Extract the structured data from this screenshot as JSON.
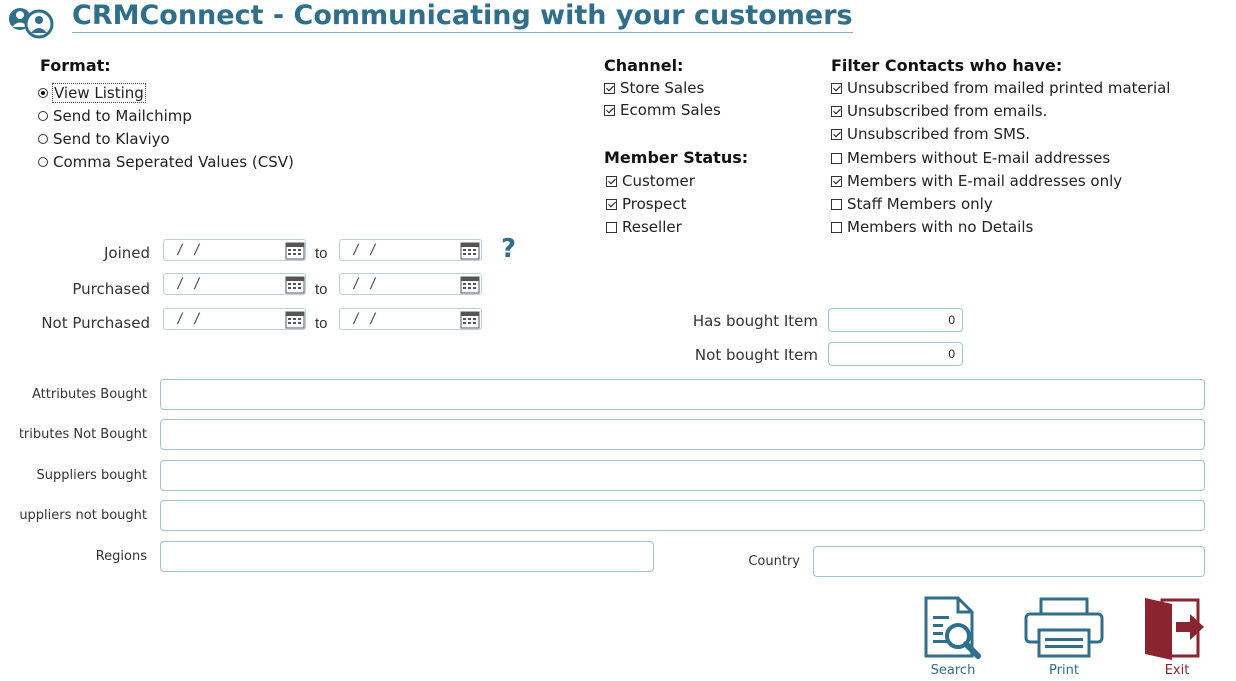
{
  "header": {
    "title": "CRMConnect - Communicating with your customers"
  },
  "format": {
    "label": "Format:",
    "options": [
      {
        "label": "View Listing",
        "selected": true
      },
      {
        "label": "Send to Mailchimp",
        "selected": false
      },
      {
        "label": "Send to Klaviyo",
        "selected": false
      },
      {
        "label": "Comma Seperated Values (CSV)",
        "selected": false
      }
    ]
  },
  "channel": {
    "label": "Channel:",
    "options": [
      {
        "label": "Store Sales",
        "checked": true
      },
      {
        "label": "Ecomm Sales",
        "checked": true
      }
    ]
  },
  "member_status": {
    "label": "Member Status:",
    "options": [
      {
        "label": "Customer",
        "checked": true
      },
      {
        "label": "Prospect",
        "checked": true
      },
      {
        "label": "Reseller",
        "checked": false
      }
    ]
  },
  "filter": {
    "label": "Filter Contacts who have:",
    "options": [
      {
        "label": "Unsubscribed from mailed printed material",
        "checked": true
      },
      {
        "label": "Unsubscribed from emails.",
        "checked": true
      },
      {
        "label": "Unsubscribed from SMS.",
        "checked": true
      },
      {
        "label": "Members without E-mail addresses",
        "checked": false
      },
      {
        "label": "Members with E-mail addresses only",
        "checked": true
      },
      {
        "label": "Staff Members only",
        "checked": false
      },
      {
        "label": "Members with no Details",
        "checked": false
      }
    ]
  },
  "dates": {
    "to_label": "to",
    "placeholder": "/ /",
    "help": "?",
    "rows": [
      {
        "label": "Joined"
      },
      {
        "label": "Purchased"
      },
      {
        "label": "Not Purchased"
      }
    ]
  },
  "items": {
    "has_bought_label": "Has bought Item",
    "has_bought_value": "0",
    "not_bought_label": "Not bought Item",
    "not_bought_value": "0"
  },
  "fields": {
    "attributes_bought": "Attributes Bought",
    "attributes_not_bought": "Attributes Not Bought",
    "suppliers_bought": "Suppliers bought",
    "suppliers_not_bought": "Suppliers not bought",
    "regions": "Regions",
    "country": "Country"
  },
  "buttons": {
    "search": "Search",
    "print": "Print",
    "exit": "Exit"
  },
  "colors": {
    "accent": "#2f6f8c",
    "exit": "#8a2530"
  }
}
